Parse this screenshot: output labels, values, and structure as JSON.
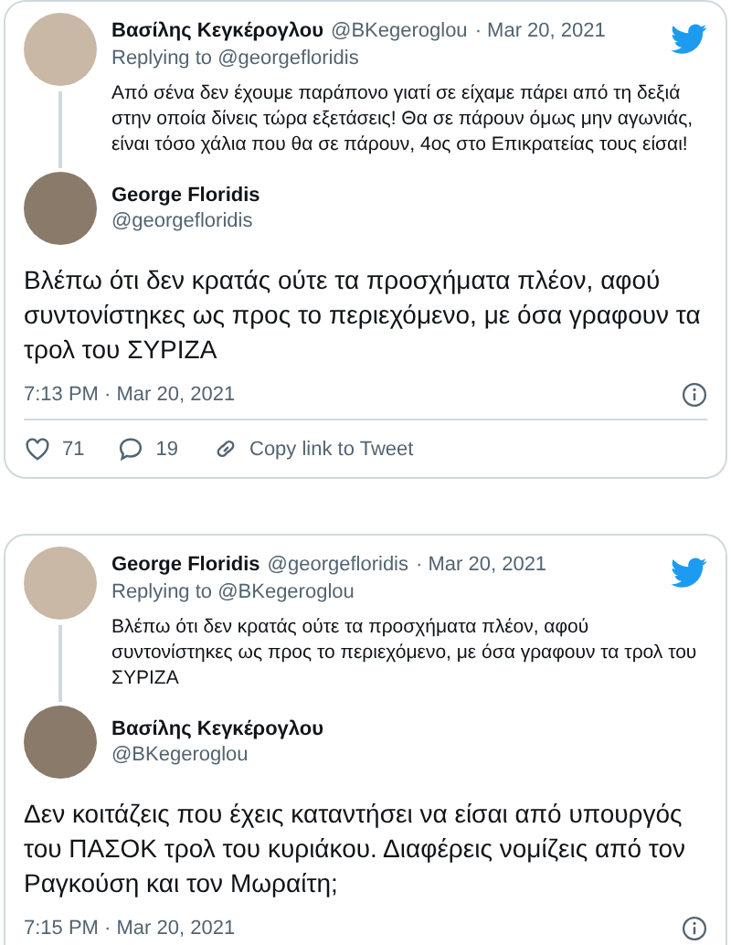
{
  "tweets": [
    {
      "context": {
        "name": "Βασίλης Κεγκέρογλου",
        "handle": "@BKegeroglou",
        "date": "· Mar 20, 2021",
        "replying_label": "Replying to",
        "replying_handle": "@georgefloridis",
        "text": "Από σένα δεν έχουμε παράπονο γιατί σε είχαμε πάρει από τη δεξιά στην οποία δίνεις τώρα εξετάσεις! Θα σε πάρουν όμως μην αγωνιάς, είναι τόσο χάλια που θα σε πάρουν, 4ος στο Επικρατείας τους είσαι!"
      },
      "main": {
        "name": "George Floridis",
        "handle": "@georgefloridis",
        "text": "Βλέπω ότι δεν κρατάς ούτε τα προσχήματα πλέον, αφού συντονίστηκες ως προς το περιεχόμενο, με όσα γραφουν τα τρολ του ΣΥΡΙΖΑ",
        "time": "7:13 PM · Mar 20, 2021"
      },
      "actions": {
        "likes": "71",
        "replies": "19",
        "copy_link": "Copy link to Tweet"
      }
    },
    {
      "context": {
        "name": "George Floridis",
        "handle": "@georgefloridis",
        "date": "· Mar 20, 2021",
        "replying_label": "Replying to",
        "replying_handle": "@BKegeroglou",
        "text": "Βλέπω ότι δεν κρατάς ούτε τα προσχήματα πλέον, αφού συντονίστηκες ως προς το περιεχόμενο, με όσα γραφουν τα τρολ του ΣΥΡΙΖΑ"
      },
      "main": {
        "name": "Βασίλης Κεγκέρογλου",
        "handle": "@BKegeroglou",
        "text": "Δεν κοιτάζεις που έχεις καταντήσει να είσαι από υπουργός του ΠΑΣΟΚ τρολ του κυριάκου. Διαφέρεις νομίζεις από τον Ραγκούση και τον Μωραίτη;",
        "time": "7:15 PM · Mar 20, 2021"
      }
    }
  ]
}
